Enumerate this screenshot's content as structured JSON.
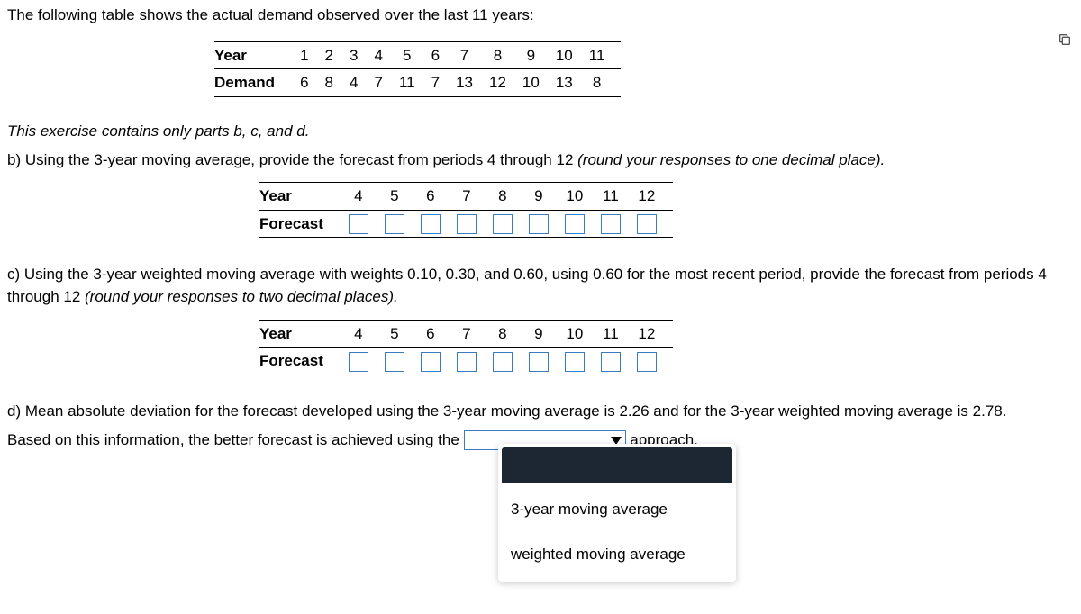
{
  "intro": "The following table shows the actual demand observed over the last 11 years:",
  "table1": {
    "yearLabel": "Year",
    "demandLabel": "Demand",
    "years": [
      "1",
      "2",
      "3",
      "4",
      "5",
      "6",
      "7",
      "8",
      "9",
      "10",
      "11"
    ],
    "demand": [
      "6",
      "8",
      "4",
      "7",
      "11",
      "7",
      "13",
      "12",
      "10",
      "13",
      "8"
    ]
  },
  "partsNote": "This exercise contains only parts b, c, and d.",
  "partB": {
    "prefix": "b) Using the 3-year moving average, provide the forecast from periods 4 through 12 ",
    "italic": "(round your responses to one decimal place).",
    "yearLabel": "Year",
    "forecastLabel": "Forecast",
    "years": [
      "4",
      "5",
      "6",
      "7",
      "8",
      "9",
      "10",
      "11",
      "12"
    ]
  },
  "partC": {
    "prefix": "c) Using the 3-year weighted moving average with weights 0.10, 0.30, and 0.60, using 0.60 for the most recent period, provide the forecast from periods 4 through 12 ",
    "italic": "(round your responses to two decimal places).",
    "yearLabel": "Year",
    "forecastLabel": "Forecast",
    "years": [
      "4",
      "5",
      "6",
      "7",
      "8",
      "9",
      "10",
      "11",
      "12"
    ]
  },
  "partD": {
    "line1": "d) Mean absolute deviation for the forecast developed using the 3-year moving average is 2.26 and for the 3-year weighted moving average is 2.78.",
    "line2a": "Based on this information, the better forecast is achieved using the",
    "line2b": " approach."
  },
  "dropdown": {
    "opt1": "3-year moving average",
    "opt2": "weighted moving average"
  }
}
